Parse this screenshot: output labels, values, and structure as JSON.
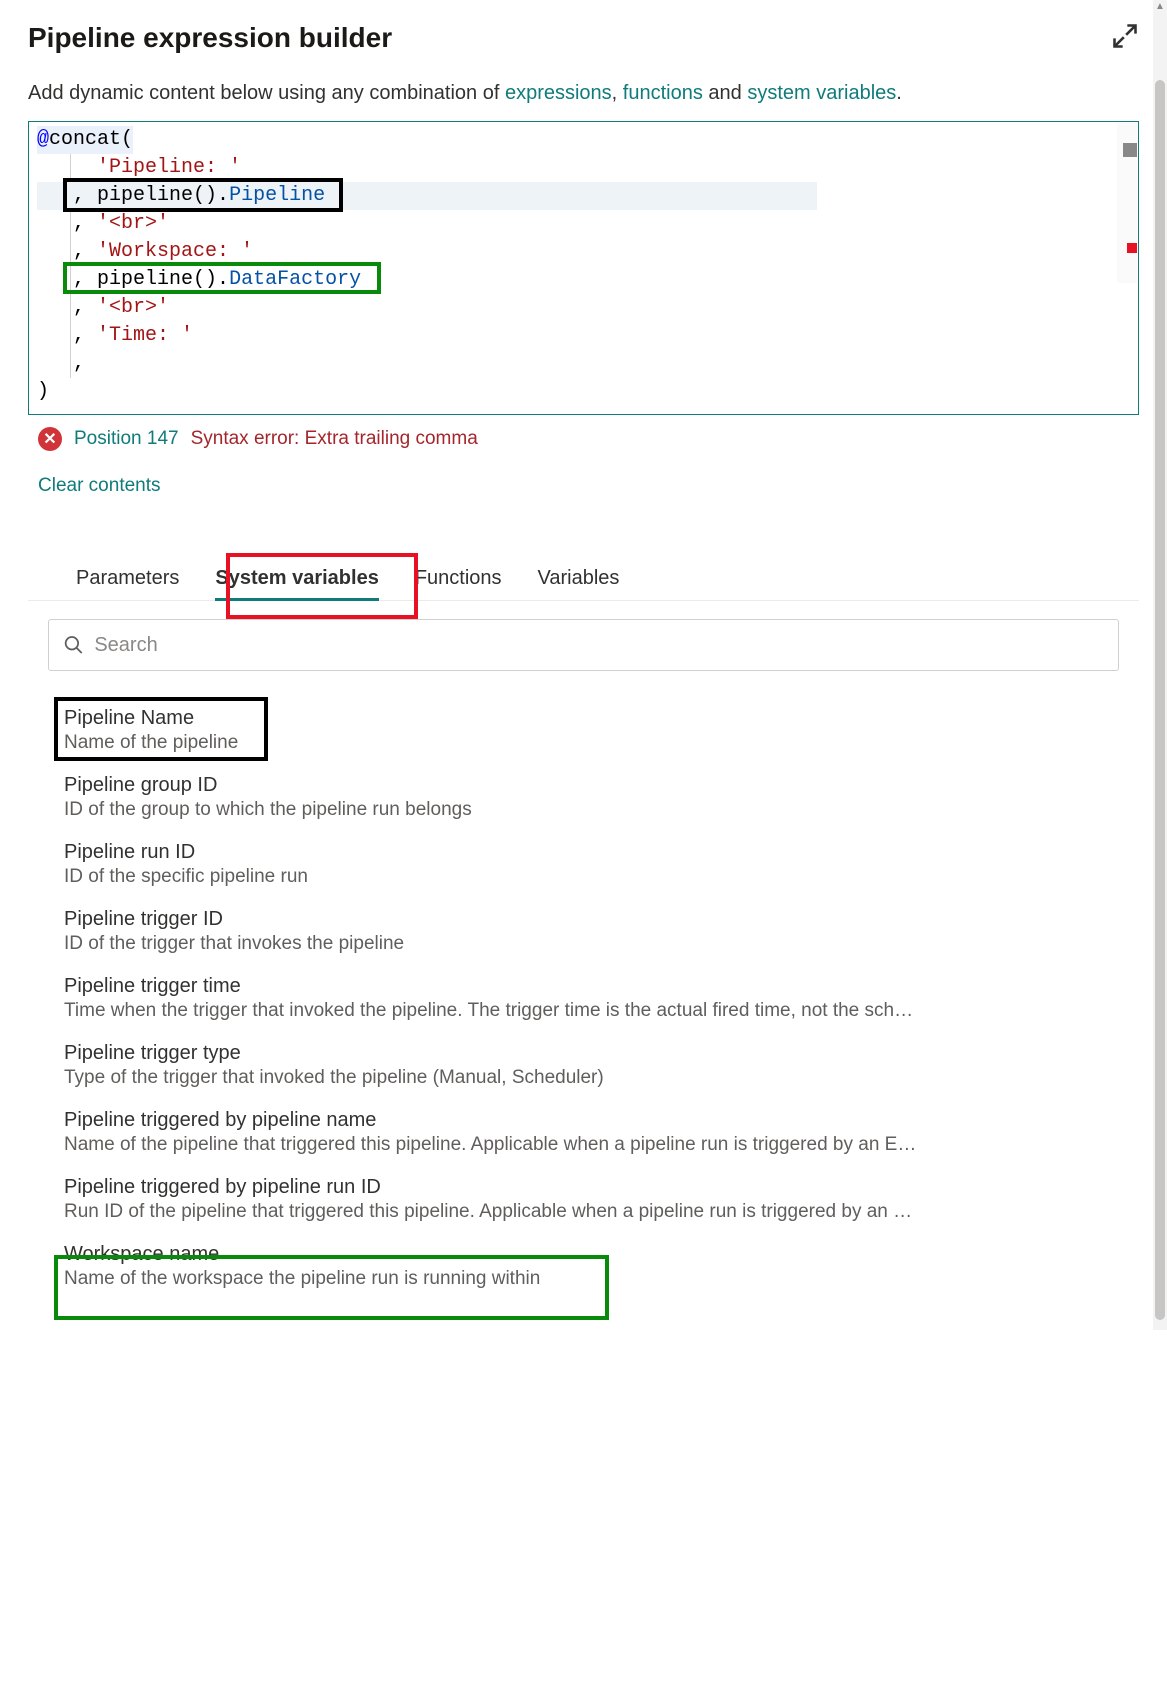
{
  "header": {
    "title": "Pipeline expression builder"
  },
  "intro": {
    "prefix": "Add dynamic content below using any combination of ",
    "link_expressions": "expressions",
    "link_functions": "functions",
    "and": " and ",
    "link_sysvars": "system variables",
    "period": "."
  },
  "editor": {
    "lines": {
      "l1_at": "@",
      "l1_concat": "concat(",
      "l2_str": "'Pipeline: '",
      "l3_comma": ", ",
      "l3_call": "pipeline().",
      "l3_prop": "Pipeline",
      "l4_comma": ", ",
      "l4_str": "'<br>'",
      "l5_comma": ", ",
      "l5_str": "'Workspace: '",
      "l6_comma": ", ",
      "l6_call": "pipeline().",
      "l6_prop": "DataFactory",
      "l7_comma": ", ",
      "l7_str": "'<br>'",
      "l8_comma": ", ",
      "l8_str": "'Time: '",
      "l9": ",",
      "l10": ")"
    }
  },
  "error": {
    "position": "Position 147",
    "message": "Syntax error: Extra trailing comma"
  },
  "clear": "Clear contents",
  "tabs": {
    "parameters": "Parameters",
    "system_variables": "System variables",
    "functions": "Functions",
    "variables": "Variables"
  },
  "search": {
    "placeholder": "Search"
  },
  "sysvars": [
    {
      "title": "Pipeline Name",
      "desc": "Name of the pipeline"
    },
    {
      "title": "Pipeline group ID",
      "desc": "ID of the group to which the pipeline run belongs"
    },
    {
      "title": "Pipeline run ID",
      "desc": "ID of the specific pipeline run"
    },
    {
      "title": "Pipeline trigger ID",
      "desc": "ID of the trigger that invokes the pipeline"
    },
    {
      "title": "Pipeline trigger time",
      "desc": "Time when the trigger that invoked the pipeline. The trigger time is the actual fired time, not the sch…"
    },
    {
      "title": "Pipeline trigger type",
      "desc": "Type of the trigger that invoked the pipeline (Manual, Scheduler)"
    },
    {
      "title": "Pipeline triggered by pipeline name",
      "desc": "Name of the pipeline that triggered this pipeline. Applicable when a pipeline run is triggered by an E…"
    },
    {
      "title": "Pipeline triggered by pipeline run ID",
      "desc": "Run ID of the pipeline that triggered this pipeline. Applicable when a pipeline run is triggered by an …"
    },
    {
      "title": "Workspace name",
      "desc": "Name of the workspace the pipeline run is running within"
    }
  ]
}
